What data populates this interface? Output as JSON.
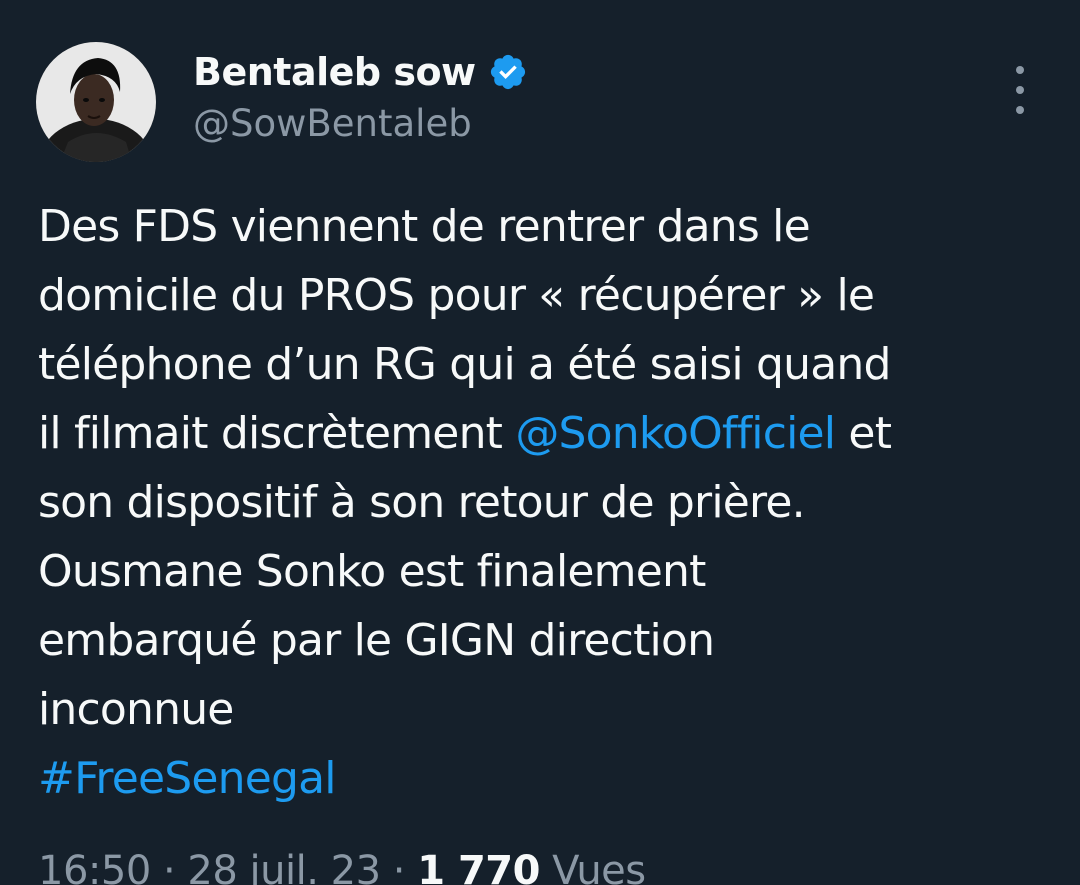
{
  "author": {
    "display_name": "Bentaleb sow",
    "handle": "@SowBentaleb",
    "verified_icon": "verified-badge-icon",
    "avatar_icon": "profile-photo"
  },
  "menu": {
    "more_icon": "more-vertical-icon"
  },
  "tweet": {
    "line1": "Des FDS viennent de rentrer dans le",
    "line2": "domicile du PROS pour « récupérer » le",
    "line3": "téléphone d’un RG qui a été saisi quand",
    "line4_before": "il filmait discrètement ",
    "mention": "@SonkoOfficiel",
    "line4_after": " et",
    "line5": "son dispositif à son retour de prière.",
    "line6": "Ousmane Sonko est finalement",
    "line7": "embarqué par le GIGN direction",
    "line8": "inconnue",
    "hashtag": "#FreeSenegal"
  },
  "meta": {
    "time_date": "16:50 · 28 juil. 23 · ",
    "views_count": "1 770",
    "views_label": " Vues"
  },
  "colors": {
    "background": "#15202b",
    "text": "#f7f9f9",
    "secondary": "#8b98a5",
    "accent": "#1d9bf0"
  }
}
